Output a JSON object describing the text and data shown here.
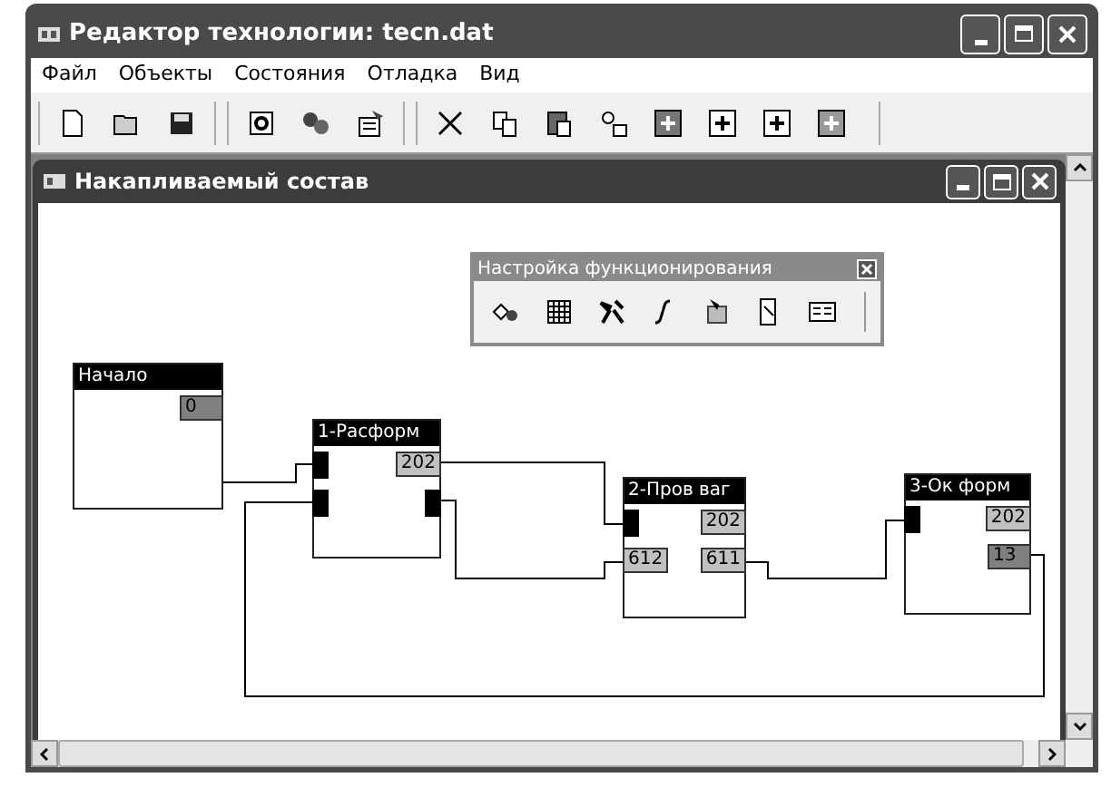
{
  "window": {
    "title": "Редактор технологии: tecn.dat"
  },
  "menu": [
    "Файл",
    "Объекты",
    "Состояния",
    "Отладка",
    "Вид"
  ],
  "child_window": {
    "title": "Накапливаемый состав"
  },
  "palette": {
    "title": "Настройка функционирования"
  },
  "nodes": [
    {
      "title": "Начало",
      "right_ports": [
        {
          "kind": "value",
          "value": "0",
          "color": "#808080"
        }
      ]
    },
    {
      "title": "1-Расформ",
      "left_ports": [
        {
          "kind": "socket"
        },
        {
          "kind": "socket"
        }
      ],
      "right_ports": [
        {
          "kind": "value",
          "value": "202",
          "color": "#c0c0c0"
        },
        {
          "kind": "socket"
        }
      ]
    },
    {
      "title": "2-Пров ваг",
      "left_ports": [
        {
          "kind": "socket"
        },
        {
          "kind": "value",
          "value": "612",
          "color": "#c0c0c0"
        }
      ],
      "right_ports": [
        {
          "kind": "value",
          "value": "202",
          "color": "#c0c0c0"
        },
        {
          "kind": "value",
          "value": "611",
          "color": "#c0c0c0"
        }
      ]
    },
    {
      "title": "3-Ок форм",
      "left_ports": [
        {
          "kind": "socket"
        }
      ],
      "right_ports": [
        {
          "kind": "value",
          "value": "202",
          "color": "#c0c0c0"
        },
        {
          "kind": "value",
          "value": "13",
          "color": "#808080"
        }
      ]
    }
  ]
}
